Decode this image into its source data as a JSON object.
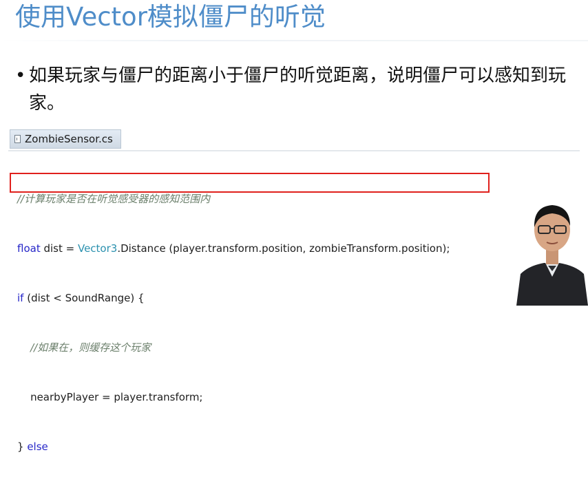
{
  "slide": {
    "title": "使用Vector模拟僵尸的听觉",
    "bullet": "如果玩家与僵尸的距离小于僵尸的听觉距离，说明僵尸可以感知到玩家。"
  },
  "editor": {
    "file_tab": "ZombieSensor.cs",
    "line1_comment": "//计算玩家是否在听觉感受器的感知范围内",
    "line2_kw": "float",
    "line2_a": " dist = ",
    "line2_type": "Vector3",
    "line2_b": ".Distance (player.transform.position, zombieTransform.position);",
    "line3_kw": "if",
    "line3_rest": " (dist < SoundRange) {",
    "line4_comment": "    //如果在，则缓存这个玩家",
    "line5": "    nearbyPlayer = player.transform;",
    "line6_a": "} ",
    "line6_kw": "else"
  },
  "colors": {
    "title": "#4f8dc9",
    "keyword": "#2626c8",
    "type": "#2b91af",
    "comment": "#6b7f6b",
    "highlight": "#e0201c"
  }
}
